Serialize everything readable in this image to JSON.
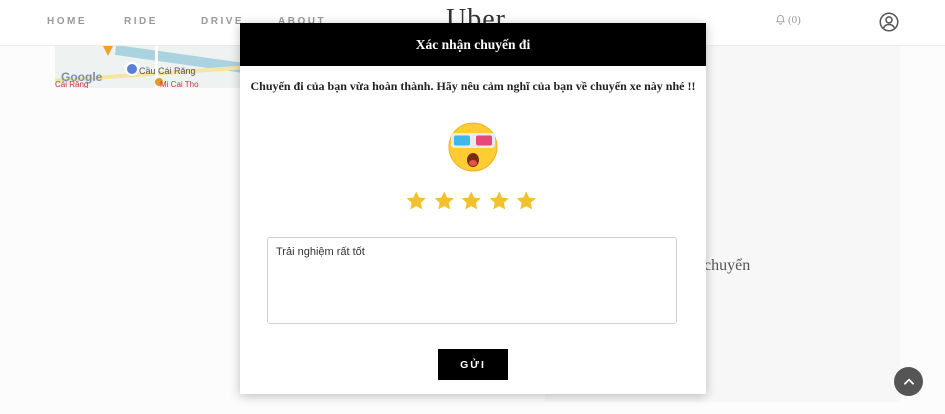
{
  "nav": {
    "links": [
      "HOME",
      "RIDE",
      "DRIVE",
      "ABOUT"
    ],
    "logo": "Uber",
    "notification_count": "(0)",
    "icons": [
      "bell-icon",
      "user-icon"
    ]
  },
  "map": {
    "watermark": "Google",
    "place_label": "Cầu Cái Răng",
    "place_label_2": "Cái Răng",
    "place_label_3": "Mi Cai Tho"
  },
  "background": {
    "partial_text": "chuyển"
  },
  "modal": {
    "title": "Xác nhận chuyến đi",
    "prompt": "Chuyến đi của bạn vừa hoàn thành. Hãy nêu cảm nghĩ của bạn về chuyến xe này nhé !!",
    "rating": 5,
    "rating_max": 5,
    "feedback_value": "Trải nghiệm rất tốt",
    "submit_label": "GỬI",
    "emoji_icon": "starstruck-3d-glasses-emoji-icon"
  },
  "colors": {
    "star": "#f2c12e",
    "header_bg": "#000000",
    "button_bg": "#000000",
    "emoji_face": "#ffcc33"
  }
}
